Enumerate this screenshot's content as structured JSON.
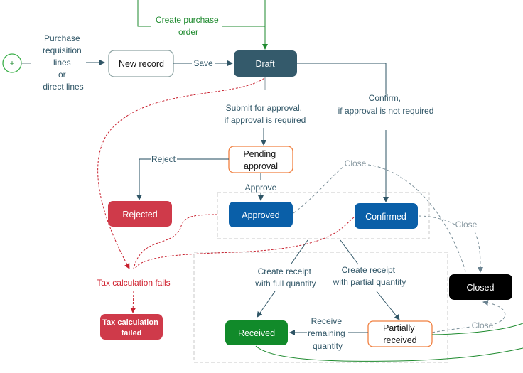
{
  "colors": {
    "draft": "#345a6b",
    "blue_state": "#0a5fa8",
    "red_state": "#cf3a4a",
    "green_state": "#118a2a",
    "closed": "#000000",
    "pending_border": "#f08040",
    "error_text": "#d0202e",
    "green_flow": "#1e8a2e"
  },
  "start": {
    "icon": "plus-icon"
  },
  "labels": {
    "source": [
      "Purchase",
      "requisition",
      "lines",
      "or",
      "direct lines"
    ],
    "save": "Save",
    "create_po": [
      "Create purchase",
      "order"
    ],
    "submit": [
      "Submit for approval,",
      "if approval is required"
    ],
    "confirm": [
      "Confirm,",
      "if approval is not required"
    ],
    "reject": "Reject",
    "approve": "Approve",
    "close_approved": "Close",
    "close_confirmed": "Close",
    "close_partial": "Close",
    "tax_fails": "Tax calculation fails",
    "receipt_full": [
      "Create receipt",
      "with full quantity"
    ],
    "receipt_partial": [
      "Create receipt",
      "with partial quantity"
    ],
    "receive_remaining": [
      "Receive",
      "remaining",
      "quantity"
    ]
  },
  "states": {
    "new_record": "New record",
    "draft": "Draft",
    "pending": [
      "Pending",
      "approval"
    ],
    "rejected": "Rejected",
    "approved": "Approved",
    "confirmed": "Confirmed",
    "closed": "Closed",
    "tax_failed": [
      "Tax calculation",
      "failed"
    ],
    "received": "Received",
    "partially_received": [
      "Partially",
      "received"
    ]
  }
}
